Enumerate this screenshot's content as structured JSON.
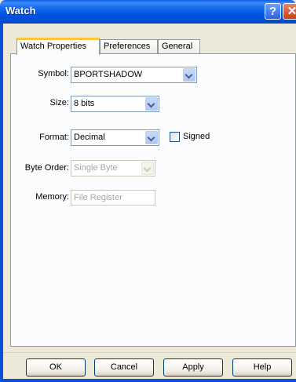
{
  "window": {
    "title": "Watch",
    "help_glyph": "?",
    "close_glyph": "✕"
  },
  "tabs": [
    {
      "label": "Watch Properties",
      "active": true
    },
    {
      "label": "Preferences",
      "active": false
    },
    {
      "label": "General",
      "active": false
    }
  ],
  "form": {
    "symbol": {
      "label": "Symbol:",
      "value": "BPORTSHADOW"
    },
    "size": {
      "label": "Size:",
      "value": "8 bits"
    },
    "format": {
      "label": "Format:",
      "value": "Decimal"
    },
    "signed": {
      "label": "Signed",
      "checked": false
    },
    "byte_order": {
      "label": "Byte Order:",
      "value": "Single Byte",
      "disabled": true
    },
    "memory": {
      "label": "Memory:",
      "value": "File Register",
      "disabled": true
    }
  },
  "buttons": {
    "ok": "OK",
    "cancel": "Cancel",
    "apply": "Apply",
    "help": "Help"
  },
  "colors": {
    "titlebar": "#0055e5",
    "dialog_bg": "#ece9d8",
    "active_tab_accent": "#ffc83c"
  },
  "icons": {
    "help": "help-icon",
    "close": "close-icon",
    "dropdown": "chevron-down-icon"
  }
}
